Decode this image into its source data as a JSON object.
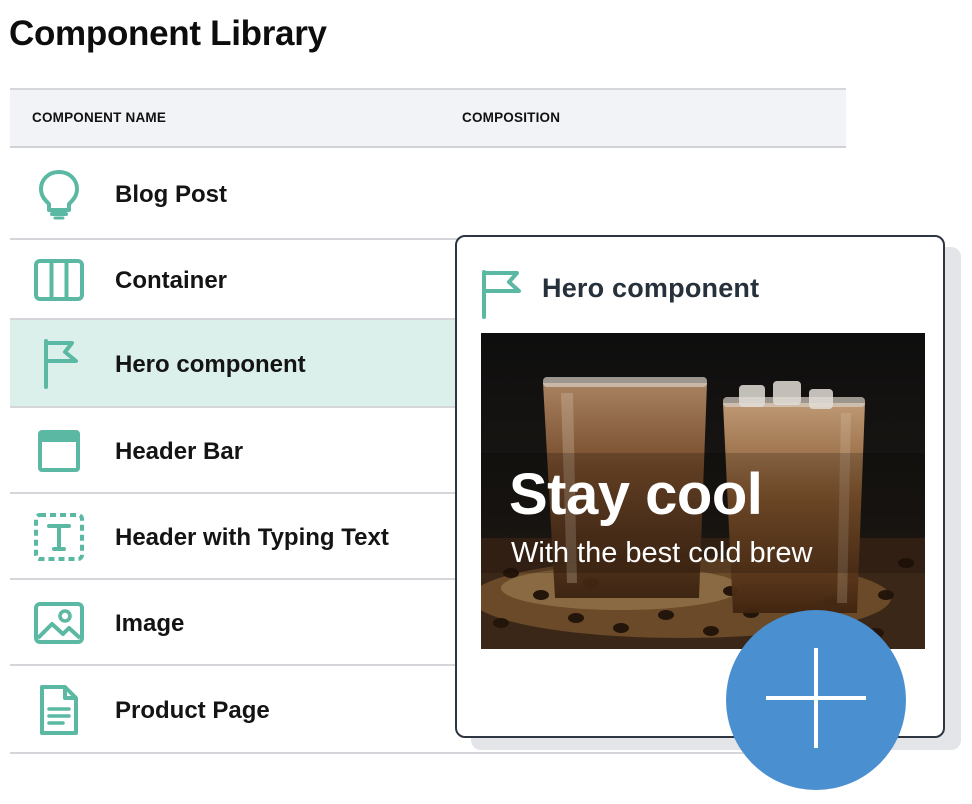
{
  "page": {
    "title": "Component Library"
  },
  "table": {
    "columns": {
      "name": "COMPONENT NAME",
      "composition": "COMPOSITION"
    },
    "rows": [
      {
        "label": "Blog Post",
        "icon": "lightbulb-icon"
      },
      {
        "label": "Container",
        "icon": "columns-icon"
      },
      {
        "label": "Hero component",
        "icon": "flag-icon",
        "selected": true
      },
      {
        "label": "Header Bar",
        "icon": "header-bar-icon"
      },
      {
        "label": "Header with Typing Text",
        "icon": "typing-text-icon"
      },
      {
        "label": "Image",
        "icon": "image-icon"
      },
      {
        "label": "Product Page",
        "icon": "document-icon"
      }
    ]
  },
  "preview": {
    "title": "Hero component",
    "icon": "flag-icon",
    "hero": {
      "headline": "Stay cool",
      "subheadline": "With the best cold brew"
    }
  },
  "fab": {
    "icon": "plus-icon"
  },
  "colors": {
    "accent": "#5bb8a3",
    "selected_row": "#dbefeb",
    "fab": "#4a8fcf",
    "header_bg": "#f2f3f6"
  }
}
